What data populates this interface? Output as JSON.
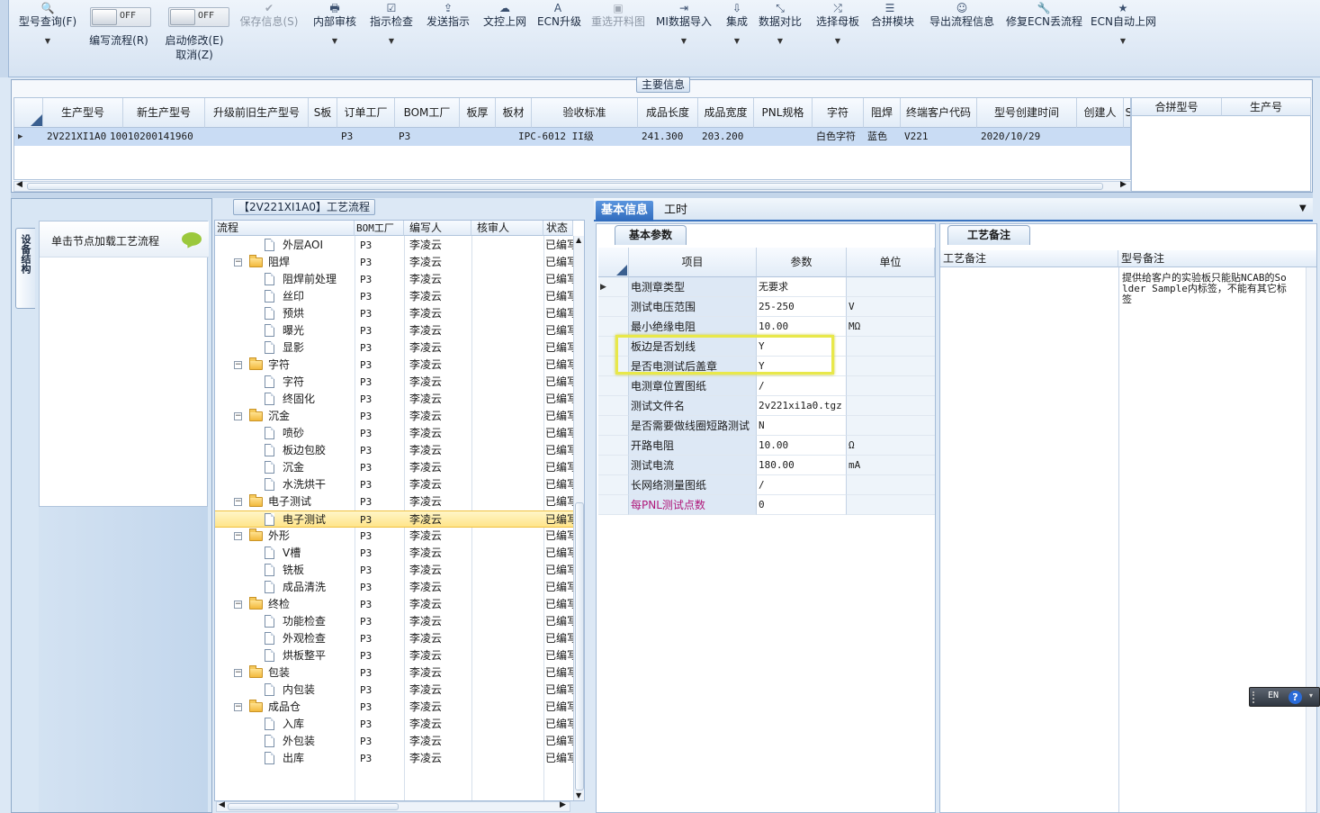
{
  "toolbar": {
    "items": [
      {
        "icon": "search-icon",
        "glyph": "🔍",
        "label": "型号查询(F)",
        "dropdown": true,
        "disabled": false
      },
      {
        "icon": "check-icon",
        "glyph": "✔",
        "label": "保存信息(S)",
        "dropdown": false,
        "disabled": true
      },
      {
        "icon": "print-icon",
        "glyph": "🖶",
        "label": "内部审核",
        "dropdown": true,
        "disabled": false
      },
      {
        "icon": "checkbox-icon",
        "glyph": "☑",
        "label": "指示检查",
        "dropdown": true,
        "disabled": false
      },
      {
        "icon": "upload-icon",
        "glyph": "⇪",
        "label": "发送指示",
        "dropdown": false,
        "disabled": false
      },
      {
        "icon": "cloud-upload-icon",
        "glyph": "☁",
        "label": "文控上网",
        "dropdown": false,
        "disabled": false
      },
      {
        "icon": "font-icon",
        "glyph": "A",
        "label": "ECN升级",
        "dropdown": false,
        "disabled": false
      },
      {
        "icon": "picture-icon",
        "glyph": "▣",
        "label": "重选开料图",
        "dropdown": false,
        "disabled": true
      },
      {
        "icon": "login-icon",
        "glyph": "⇥",
        "label": "MI数据导入",
        "dropdown": true,
        "disabled": false
      },
      {
        "icon": "download-icon",
        "glyph": "⇩",
        "label": "集成",
        "dropdown": true,
        "disabled": false
      },
      {
        "icon": "compress-icon",
        "glyph": "⤡",
        "label": "数据对比",
        "dropdown": true,
        "disabled": false
      },
      {
        "icon": "random-icon",
        "glyph": "⤮",
        "label": "选择母板",
        "dropdown": true,
        "disabled": false
      },
      {
        "icon": "list-icon",
        "glyph": "☰",
        "label": "合拼模块",
        "dropdown": false,
        "disabled": false
      },
      {
        "icon": "smile-icon",
        "glyph": "☺",
        "label": "导出流程信息",
        "dropdown": false,
        "disabled": false
      },
      {
        "icon": "wrench-icon",
        "glyph": "🔧",
        "label": "修复ECN丢流程",
        "dropdown": false,
        "disabled": false
      },
      {
        "icon": "star-icon",
        "glyph": "★",
        "label": "ECN自动上网",
        "dropdown": true,
        "disabled": false
      }
    ],
    "toggle_edit": {
      "state": "OFF",
      "label": "编写流程(R)"
    },
    "toggle_modify": {
      "state": "OFF",
      "label1": "启动修改(E)",
      "label2": "取消(Z)"
    }
  },
  "main_info": {
    "title": "主要信息",
    "columns": [
      "生产型号",
      "新生产型号",
      "升级前旧生产型号",
      "S板",
      "订单工厂",
      "BOM工厂",
      "板厚",
      "板材",
      "验收标准",
      "成品长度",
      "成品宽度",
      "PNL规格",
      "字符",
      "阻焊",
      "终端客户代码",
      "型号创建时间",
      "创建人",
      "SC"
    ],
    "row": [
      "2V221XI1A0",
      "10010200141960",
      "",
      "",
      "P3",
      "P3",
      "",
      "",
      "IPC-6012 II级",
      "241.300",
      "203.200",
      "",
      "白色字符",
      "蓝色",
      "V221",
      "2020/10/29",
      "",
      ""
    ],
    "side_columns": [
      "合拼型号",
      "生产号"
    ]
  },
  "left_panel": {
    "vtab_label": "设备结构",
    "hint": "单击节点加载工艺流程"
  },
  "process": {
    "title": "【2V221XI1A0】工艺流程",
    "columns": [
      "流程",
      "BOM工厂",
      "编写人",
      "核审人",
      "状态"
    ],
    "rows": [
      {
        "name": "外层AOI",
        "level": 1,
        "bom": "P3",
        "writer": "李凌云",
        "status": "已编写"
      },
      {
        "name": "阻焊",
        "level": 0,
        "bom": "P3",
        "writer": "李凌云",
        "status": "已编写"
      },
      {
        "name": "阻焊前处理",
        "level": 1,
        "bom": "P3",
        "writer": "李凌云",
        "status": "已编写"
      },
      {
        "name": "丝印",
        "level": 1,
        "bom": "P3",
        "writer": "李凌云",
        "status": "已编写"
      },
      {
        "name": "预烘",
        "level": 1,
        "bom": "P3",
        "writer": "李凌云",
        "status": "已编写"
      },
      {
        "name": "曝光",
        "level": 1,
        "bom": "P3",
        "writer": "李凌云",
        "status": "已编写"
      },
      {
        "name": "显影",
        "level": 1,
        "bom": "P3",
        "writer": "李凌云",
        "status": "已编写"
      },
      {
        "name": "字符",
        "level": 0,
        "bom": "P3",
        "writer": "李凌云",
        "status": "已编写"
      },
      {
        "name": "字符",
        "level": 1,
        "bom": "P3",
        "writer": "李凌云",
        "status": "已编写"
      },
      {
        "name": "终固化",
        "level": 1,
        "bom": "P3",
        "writer": "李凌云",
        "status": "已编写"
      },
      {
        "name": "沉金",
        "level": 0,
        "bom": "P3",
        "writer": "李凌云",
        "status": "已编写"
      },
      {
        "name": "喷砂",
        "level": 1,
        "bom": "P3",
        "writer": "李凌云",
        "status": "已编写"
      },
      {
        "name": "板边包胶",
        "level": 1,
        "bom": "P3",
        "writer": "李凌云",
        "status": "已编写"
      },
      {
        "name": "沉金",
        "level": 1,
        "bom": "P3",
        "writer": "李凌云",
        "status": "已编写"
      },
      {
        "name": "水洗烘干",
        "level": 1,
        "bom": "P3",
        "writer": "李凌云",
        "status": "已编写"
      },
      {
        "name": "电子测试",
        "level": 0,
        "bom": "P3",
        "writer": "李凌云",
        "status": "已编写"
      },
      {
        "name": "电子测试",
        "level": 1,
        "bom": "P3",
        "writer": "李凌云",
        "status": "已编写",
        "selected": true
      },
      {
        "name": "外形",
        "level": 0,
        "bom": "P3",
        "writer": "李凌云",
        "status": "已编写"
      },
      {
        "name": "V槽",
        "level": 1,
        "bom": "P3",
        "writer": "李凌云",
        "status": "已编写"
      },
      {
        "name": "铣板",
        "level": 1,
        "bom": "P3",
        "writer": "李凌云",
        "status": "已编写"
      },
      {
        "name": "成品清洗",
        "level": 1,
        "bom": "P3",
        "writer": "李凌云",
        "status": "已编写"
      },
      {
        "name": "终检",
        "level": 0,
        "bom": "P3",
        "writer": "李凌云",
        "status": "已编写"
      },
      {
        "name": "功能检查",
        "level": 1,
        "bom": "P3",
        "writer": "李凌云",
        "status": "已编写"
      },
      {
        "name": "外观检查",
        "level": 1,
        "bom": "P3",
        "writer": "李凌云",
        "status": "已编写"
      },
      {
        "name": "烘板整平",
        "level": 1,
        "bom": "P3",
        "writer": "李凌云",
        "status": "已编写"
      },
      {
        "name": "包装",
        "level": 0,
        "bom": "P3",
        "writer": "李凌云",
        "status": "已编写"
      },
      {
        "name": "内包装",
        "level": 1,
        "bom": "P3",
        "writer": "李凌云",
        "status": "已编写"
      },
      {
        "name": "成品仓",
        "level": 0,
        "bom": "P3",
        "writer": "李凌云",
        "status": "已编写"
      },
      {
        "name": "入库",
        "level": 1,
        "bom": "P3",
        "writer": "李凌云",
        "status": "已编写"
      },
      {
        "name": "外包装",
        "level": 1,
        "bom": "P3",
        "writer": "李凌云",
        "status": "已编写"
      },
      {
        "name": "出库",
        "level": 1,
        "bom": "P3",
        "writer": "李凌云",
        "status": "已编写"
      }
    ]
  },
  "right_tabs": [
    "基本信息",
    "工时"
  ],
  "basic_params": {
    "subtab": "基本参数",
    "columns": [
      "项目",
      "参数",
      "单位"
    ],
    "rows": [
      {
        "item": "电测章类型",
        "value": "无要求",
        "unit": ""
      },
      {
        "item": "测试电压范围",
        "value": "25-250",
        "unit": "V"
      },
      {
        "item": "最小绝缘电阻",
        "value": "10.00",
        "unit": "MΩ"
      },
      {
        "item": "板边是否划线",
        "value": "Y",
        "unit": ""
      },
      {
        "item": "是否电测试后盖章",
        "value": "Y",
        "unit": ""
      },
      {
        "item": "电测章位置图纸",
        "value": "/",
        "unit": ""
      },
      {
        "item": "测试文件名",
        "value": "2v221xi1a0.tgz",
        "unit": ""
      },
      {
        "item": "是否需要做线圈短路测试",
        "value": "N",
        "unit": ""
      },
      {
        "item": "开路电阻",
        "value": "10.00",
        "unit": "Ω"
      },
      {
        "item": "测试电流",
        "value": "180.00",
        "unit": "mA"
      },
      {
        "item": "长网络测量图纸",
        "value": "/",
        "unit": ""
      },
      {
        "item": "每PNL测试点数",
        "value": "0",
        "unit": "",
        "pink": true
      }
    ]
  },
  "notes": {
    "subtab": "工艺备注",
    "columns": [
      "工艺备注",
      "型号备注"
    ],
    "model_note": "提供给客户的实验板只能贴NCAB的Solder Sample内标签，不能有其它标签"
  },
  "langbar": {
    "lang": "EN",
    "help": "?"
  }
}
